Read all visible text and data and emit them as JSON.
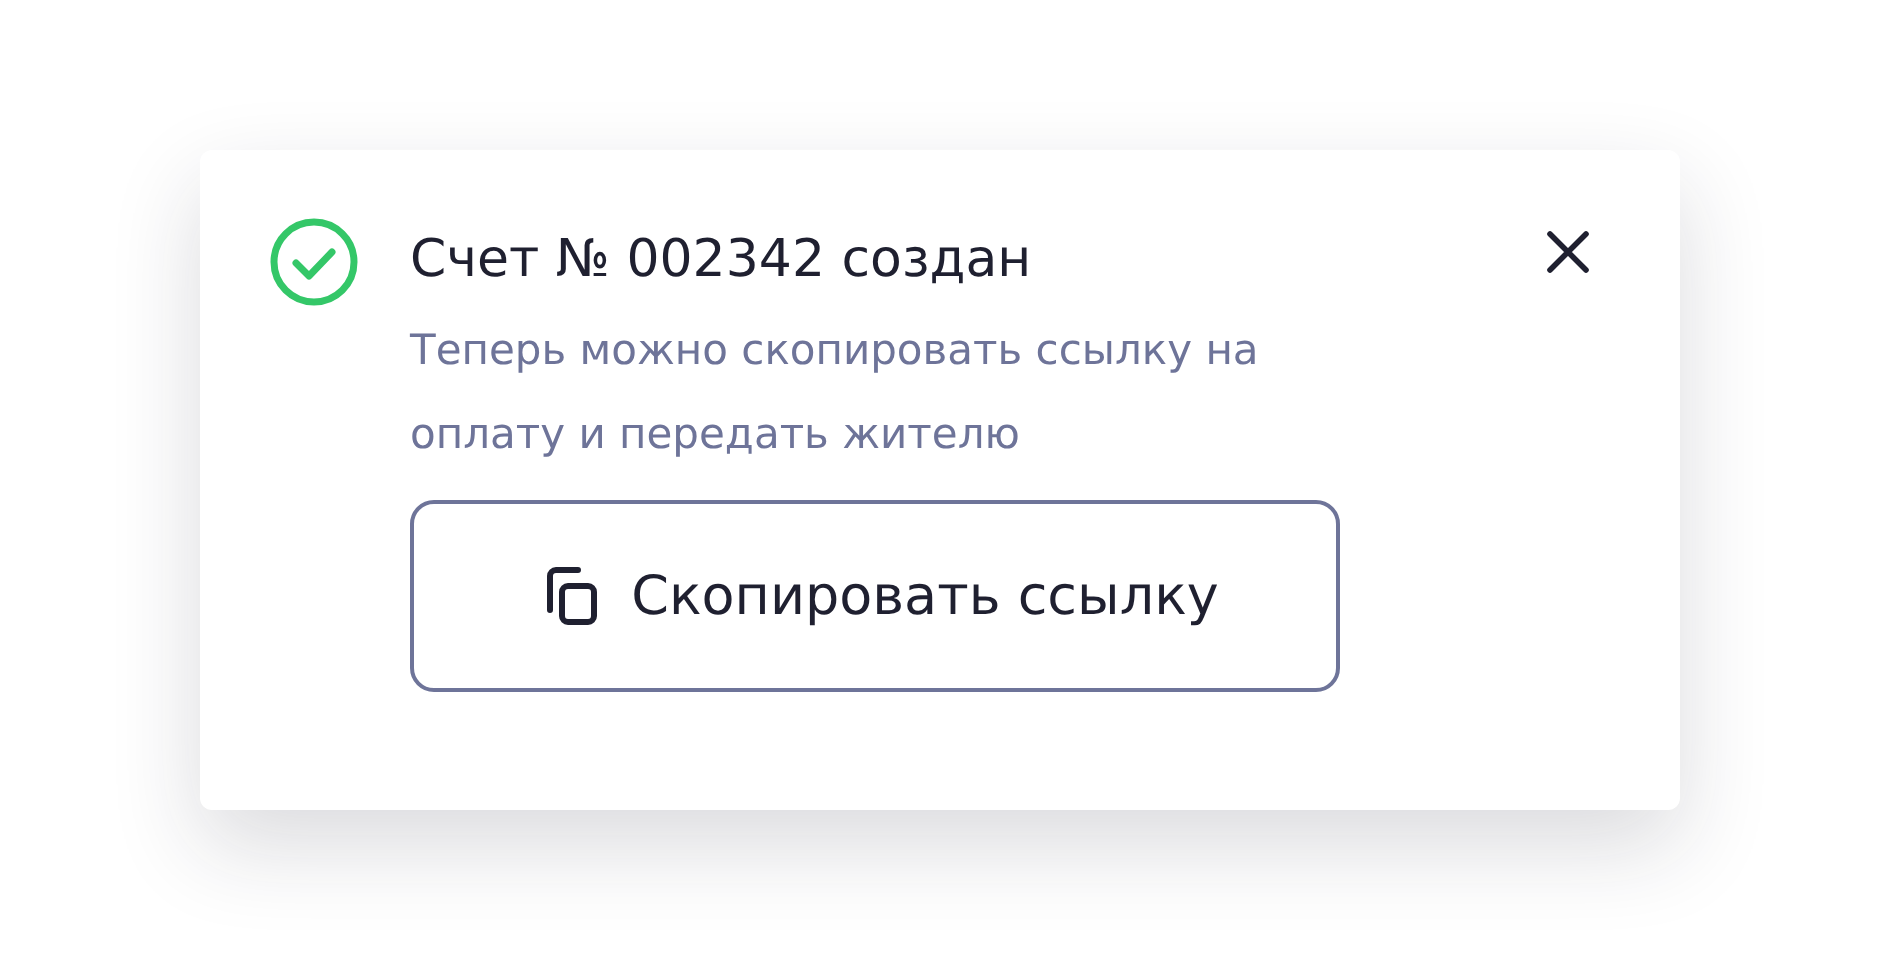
{
  "toast": {
    "kind": "success",
    "title": "Счет № 002342 создан",
    "message": "Теперь можно скопировать ссылку на оплату и передать жителю",
    "action": {
      "label": "Скопировать ссылку"
    }
  }
}
